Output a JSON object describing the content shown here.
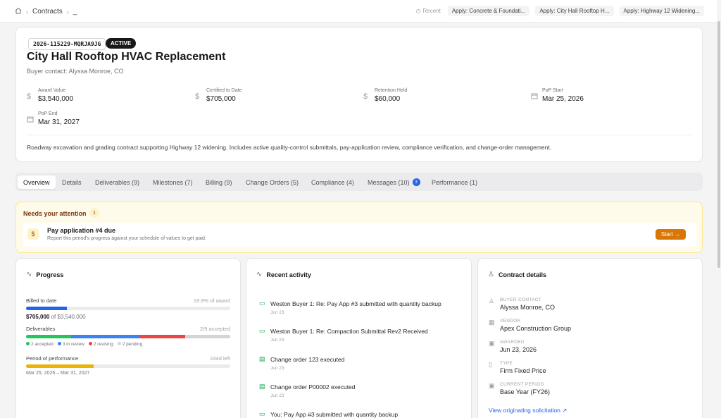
{
  "breadcrumb": {
    "home_icon": "home-icon",
    "section": "Contracts",
    "current": "_"
  },
  "recent": {
    "label": "Recent",
    "items": [
      "Apply: Concrete & Foundati...",
      "Apply: City Hall Rooftop H...",
      "Apply: Highway 12 Widening..."
    ]
  },
  "contract": {
    "number": "2026-115229-MQRJA9JG",
    "status": "ACTIVE",
    "title": "City Hall Rooftop HVAC Replacement",
    "buyer": "Buyer contact: Alyssa Monroe, CO",
    "stats": [
      {
        "label": "Award Value",
        "value": "$3,540,000",
        "icon": "dollar-icon"
      },
      {
        "label": "Certified to Date",
        "value": "$705,000",
        "icon": "dollar-icon"
      },
      {
        "label": "Retention Held",
        "value": "$60,000",
        "icon": "dollar-icon"
      },
      {
        "label": "PoP Start",
        "value": "Mar 25, 2026",
        "icon": "calendar-icon"
      },
      {
        "label": "PoP End",
        "value": "Mar 31, 2027",
        "icon": "calendar-icon"
      }
    ],
    "description": "Roadway excavation and grading contract supporting Highway 12 widening. Includes active quality-control submittals, pay-application review, compliance verification, and change-order management."
  },
  "tabs": [
    {
      "label": "Overview"
    },
    {
      "label": "Details"
    },
    {
      "label": "Deliverables (9)"
    },
    {
      "label": "Milestones (7)"
    },
    {
      "label": "Billing (9)"
    },
    {
      "label": "Change Orders (5)"
    },
    {
      "label": "Compliance (4)"
    },
    {
      "label": "Messages (10)",
      "badge": "3"
    },
    {
      "label": "Performance (1)"
    }
  ],
  "attention": {
    "title": "Needs your attention",
    "count": "1",
    "task_title": "Pay application #4 due",
    "task_sub": "Report this period's progress against your schedule of values to get paid.",
    "button": "Start →"
  },
  "progress": {
    "title": "Progress",
    "billed_label": "Billed to date",
    "billed_pct_text": "19.9% of award",
    "billed_fraction": 0.199,
    "billed_amount": "$705,000",
    "billed_of": "of $3,540,000",
    "deliv_label": "Deliverables",
    "deliv_accepted_text": "2/9 accepted",
    "deliv_segments": [
      {
        "count": 2,
        "color": "#22c55e",
        "label": "2 accepted"
      },
      {
        "count": 3,
        "color": "#3b82f6",
        "label": "3 in review"
      },
      {
        "count": 2,
        "color": "#ef4444",
        "label": "2 revising"
      },
      {
        "count": 2,
        "color": "#d4d4d8",
        "label": "2 pending"
      }
    ],
    "period_label": "Period of performance",
    "period_left": "244d left",
    "period_fraction": 0.33,
    "period_range": "Mar 25, 2026 – Mar 31, 2027"
  },
  "activity": {
    "title": "Recent activity",
    "items": [
      {
        "text": "Weston Buyer 1: Re: Pay App #3 submitted with quantity backup",
        "date": "Jun 23",
        "icon": "message-icon"
      },
      {
        "text": "Weston Buyer 1: Re: Compaction Submittal Rev2 Received",
        "date": "Jun 23",
        "icon": "message-icon"
      },
      {
        "text": "Change order 123 executed",
        "date": "Jun 23",
        "icon": "document-icon"
      },
      {
        "text": "Change order P00002 executed",
        "date": "Jun 23",
        "icon": "document-icon"
      },
      {
        "text": "You: Pay App #3 submitted with quantity backup",
        "date": "",
        "icon": "message-icon"
      }
    ]
  },
  "details": {
    "title": "Contract details",
    "rows": [
      {
        "label": "BUYER CONTACT",
        "value": "Alyssa Monroe, CO",
        "icon": "user-icon"
      },
      {
        "label": "VENDOR",
        "value": "Apex Construction Group",
        "icon": "building-icon"
      },
      {
        "label": "AWARDED",
        "value": "Jun 23, 2026",
        "icon": "calendar-icon"
      },
      {
        "label": "TYPE",
        "value": "Firm Fixed Price",
        "icon": "file-icon"
      },
      {
        "label": "CURRENT PERIOD",
        "value": "Base Year (FY26)",
        "icon": "calendar-icon"
      }
    ],
    "link": "View originating solicitation"
  },
  "colors": {
    "accent": "#2563eb",
    "warning": "#d97706",
    "period_bar": "#eab308"
  }
}
